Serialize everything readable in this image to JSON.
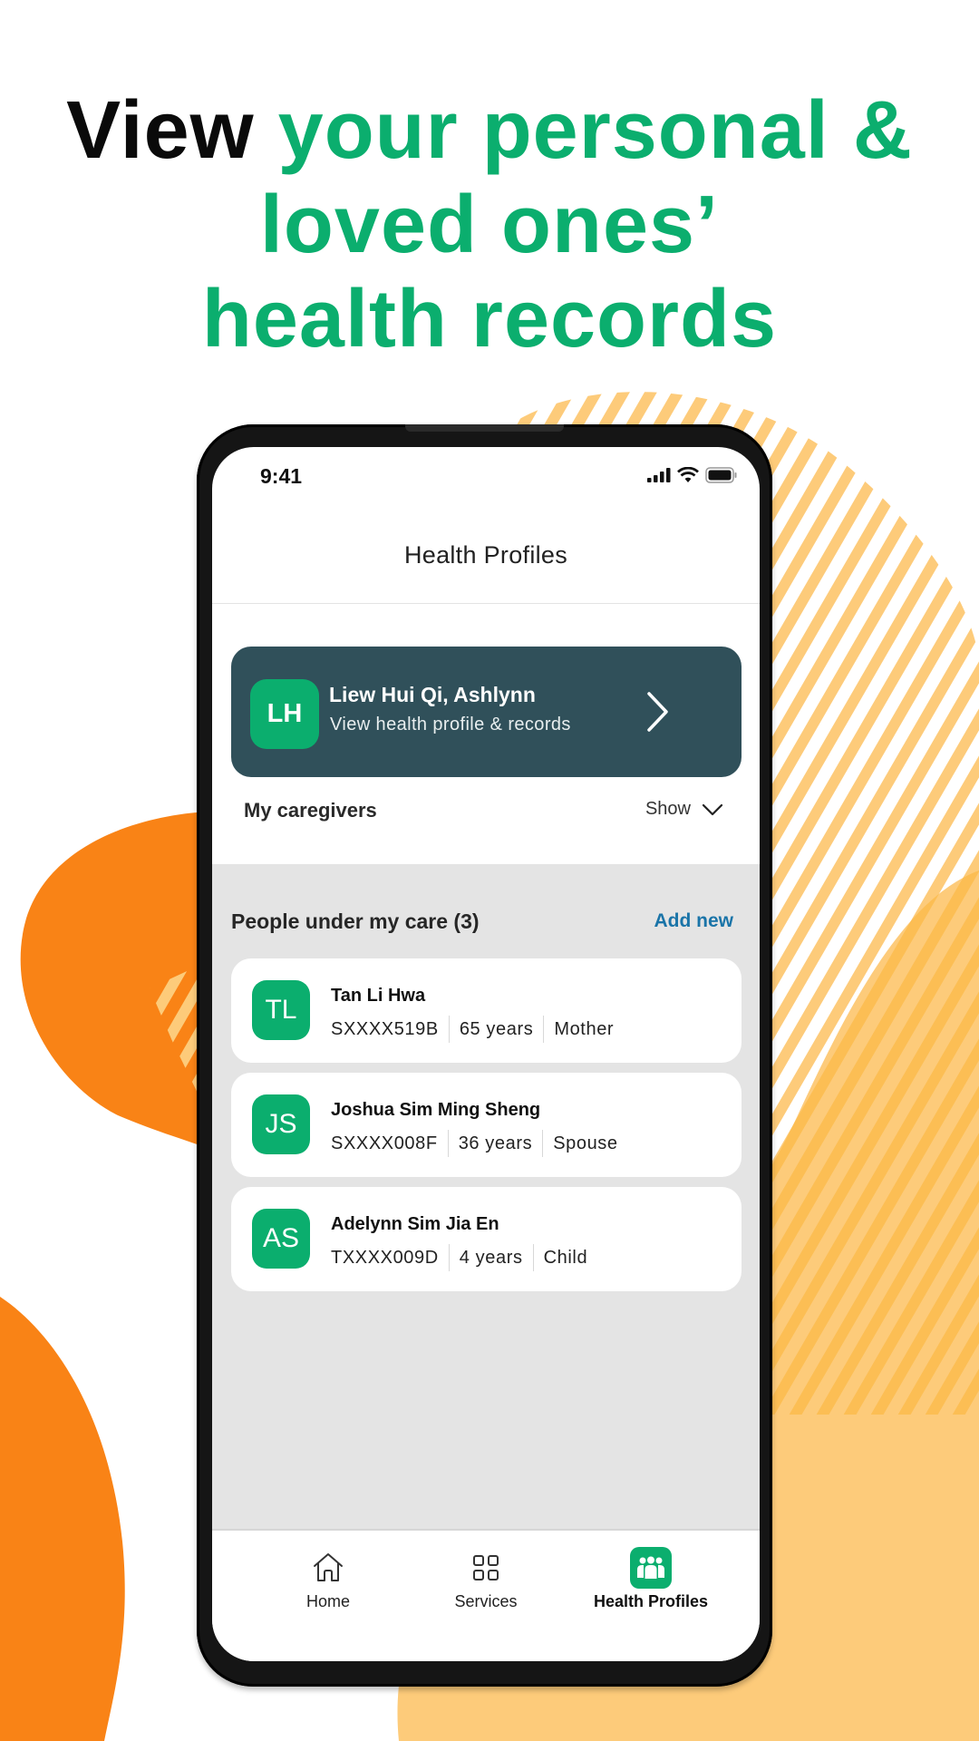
{
  "headline": {
    "dark_part": "View",
    "line1_green": "your personal &",
    "line2": "loved ones’",
    "line3": "health records"
  },
  "colors": {
    "brand_green": "#0BAE6E",
    "card_dark": "#30505A",
    "link_blue": "#1A74A8",
    "orange": "#F98316",
    "yellow": "#FDCB7A"
  },
  "status_bar": {
    "time": "9:41",
    "icons": [
      "signal-icon",
      "wifi-icon",
      "battery-icon"
    ]
  },
  "header": {
    "title": "Health Profiles"
  },
  "my_profile": {
    "initials": "LH",
    "name": "Liew Hui Qi, Ashlynn",
    "subtitle": "View health profile & records",
    "icon": "chevron-right-icon"
  },
  "caregivers": {
    "label": "My caregivers",
    "toggle_label": "Show",
    "toggle_icon": "chevron-down-icon"
  },
  "care": {
    "title": "People under my care (3)",
    "add_new_label": "Add new",
    "people": [
      {
        "initials": "TL",
        "name": "Tan Li Hwa",
        "id": "SXXXX519B",
        "age": "65 years",
        "relation": "Mother"
      },
      {
        "initials": "JS",
        "name": "Joshua Sim Ming Sheng",
        "id": "SXXXX008F",
        "age": "36 years",
        "relation": "Spouse"
      },
      {
        "initials": "AS",
        "name": "Adelynn Sim Jia En",
        "id": "TXXXX009D",
        "age": "4 years",
        "relation": "Child"
      }
    ]
  },
  "tab_bar": {
    "tabs": [
      {
        "label": "Home",
        "icon": "home-icon",
        "active": false
      },
      {
        "label": "Services",
        "icon": "grid-icon",
        "active": false
      },
      {
        "label": "Health Profiles",
        "icon": "people-icon",
        "active": true
      }
    ]
  }
}
